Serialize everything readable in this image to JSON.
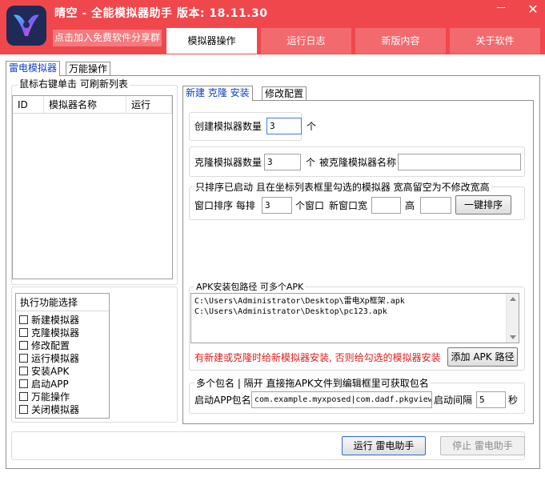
{
  "window": {
    "title": "晴空 - 全能模拟器助手  版本: 18.11.30",
    "share_link": "点击加入免费软件分享群",
    "minimize": "—",
    "close": "✕"
  },
  "main_tabs": [
    {
      "label": "模拟器操作"
    },
    {
      "label": "运行日志"
    },
    {
      "label": "新版内容"
    },
    {
      "label": "关于软件"
    }
  ],
  "sub_tabs": [
    {
      "label": "雷电模拟器"
    },
    {
      "label": "万能操作"
    }
  ],
  "left_panel": {
    "group_label": "鼠标右键单击 可刷新列表",
    "columns": [
      "ID",
      "模拟器名称",
      "运行"
    ],
    "function_header": "执行功能选择",
    "functions": [
      "新建模拟器",
      "克隆模拟器",
      "修改配置",
      "运行模拟器",
      "安装APK",
      "启动APP",
      "万能操作",
      "关闭模拟器"
    ]
  },
  "right_tabs": [
    {
      "label": "新建 克隆 安装"
    },
    {
      "label": "修改配置"
    }
  ],
  "create": {
    "label": "创建模拟器数量",
    "value": "3",
    "unit": "个"
  },
  "clone": {
    "label": "克隆模拟器数量",
    "value": "3",
    "unit": "个",
    "source_label": "被克隆模拟器名称",
    "source_value": ""
  },
  "arrange": {
    "group_label": "只排序已启动 且在坐标列表框里勾选的模拟器 宽高留空为不修改宽高",
    "row_label": "窗口排序  每排",
    "per_row_value": "3",
    "per_row_unit": "个窗口",
    "width_label": "新窗口宽",
    "width_value": "",
    "height_label": "高",
    "height_value": "",
    "button": "一键排序"
  },
  "apk": {
    "group_label": "APK安装包路径 可多个APK",
    "paths": [
      "C:\\Users\\Administrator\\Desktop\\雷电Xp框架.apk",
      "C:\\Users\\Administrator\\Desktop\\pc123.apk"
    ],
    "hint": "有新建或克隆时给新模拟器安装, 否则给勾选的模拟器安装",
    "add_button": "添加 APK 路径"
  },
  "app": {
    "group_label": "多个包名 | 隔开  直接拖APK文件到编辑框里可获取包名",
    "package_label": "启动APP包名",
    "package_value": "com.example.myxposed|com.dadf.pkgview",
    "interval_label": "启动间隔",
    "interval_value": "5",
    "interval_unit": "秒"
  },
  "footer": {
    "run_button": "运行 雷电助手",
    "stop_button": "停止 雷电助手"
  },
  "colors": {
    "titlebar": "#f0474c",
    "hint_red": "#e02020",
    "link_blue": "#1040c0"
  }
}
